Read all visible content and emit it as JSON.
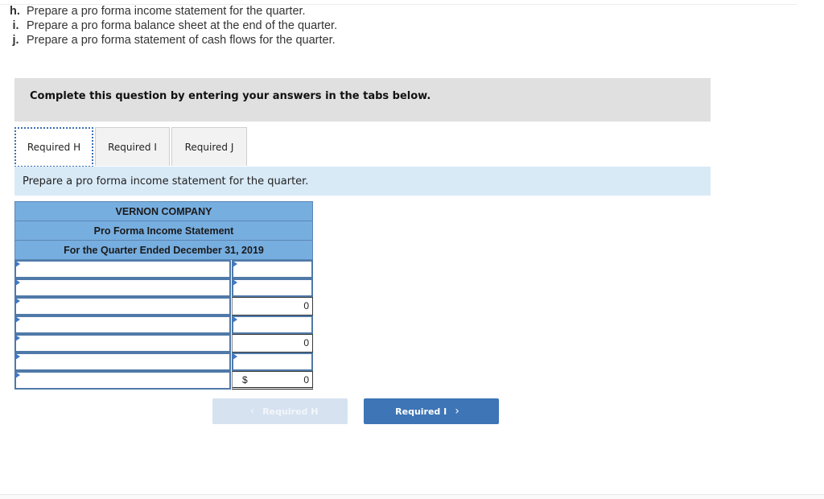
{
  "requirements": [
    {
      "letter": "h.",
      "text": "Prepare a pro forma income statement for the quarter."
    },
    {
      "letter": "i.",
      "text": "Prepare a pro forma balance sheet at the end of the quarter."
    },
    {
      "letter": "j.",
      "text": "Prepare a pro forma statement of cash flows for the quarter."
    }
  ],
  "banner": "Complete this question by entering your answers in the tabs below.",
  "tabs": [
    {
      "label": "Required H",
      "active": true
    },
    {
      "label": "Required I",
      "active": false
    },
    {
      "label": "Required J",
      "active": false
    }
  ],
  "instruction": "Prepare a pro forma income statement for the quarter.",
  "statement": {
    "company": "VERNON COMPANY",
    "title": "Pro Forma Income Statement",
    "period": "For the Quarter Ended December 31, 2019",
    "rows": [
      {
        "label": "",
        "amount": "",
        "amount_editable": true,
        "currency": ""
      },
      {
        "label": "",
        "amount": "",
        "amount_editable": true,
        "currency": ""
      },
      {
        "label": "",
        "amount": "0",
        "amount_editable": false,
        "currency": ""
      },
      {
        "label": "",
        "amount": "",
        "amount_editable": true,
        "currency": ""
      },
      {
        "label": "",
        "amount": "0",
        "amount_editable": false,
        "currency": ""
      },
      {
        "label": "",
        "amount": "",
        "amount_editable": true,
        "currency": ""
      },
      {
        "label": "",
        "amount": "0",
        "amount_editable": false,
        "currency": "$"
      }
    ]
  },
  "nav": {
    "prev_label": "Required H",
    "prev_icon": "chevron-left-icon",
    "prev_chevron": "‹",
    "next_label": "Required I",
    "next_icon": "chevron-right-icon",
    "next_chevron": "›"
  }
}
